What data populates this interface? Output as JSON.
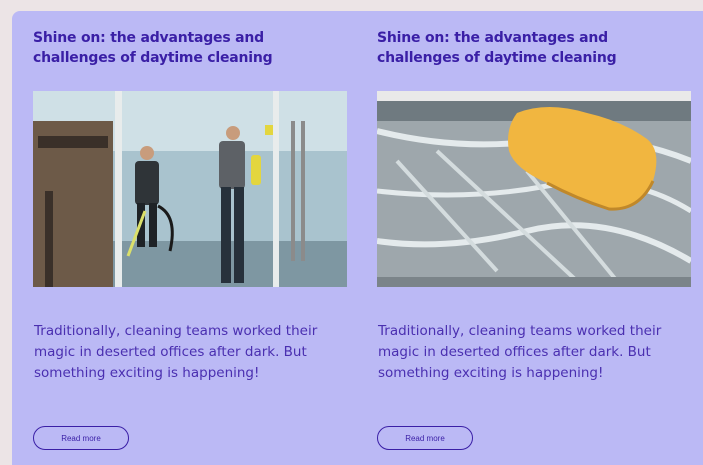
{
  "cards": [
    {
      "title": "Shine on: the advantages and challenges of daytime cleaning",
      "image": "office-cleaning-photo",
      "description": "Traditionally, cleaning teams worked their magic in deserted offices after dark. But something exciting is happening!",
      "button_label": "Read more"
    },
    {
      "title": "Shine on: the advantages and challenges of daytime cleaning",
      "image": "sponge-on-glass-photo",
      "description": "Traditionally, cleaning teams worked their magic in deserted offices after dark. But something exciting is happening!",
      "button_label": "Read more"
    }
  ],
  "colors": {
    "page_background": "#ece4e6",
    "panel_background": "#bbb9f5",
    "text_accent": "#3a1fa6"
  }
}
